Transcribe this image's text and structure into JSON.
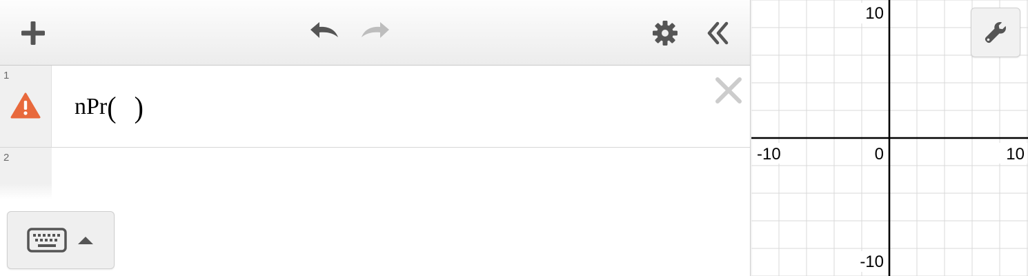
{
  "toolbar": {
    "add_icon": "plus-icon",
    "undo_icon": "undo-icon",
    "redo_icon": "redo-icon",
    "settings_icon": "gear-icon",
    "collapse_icon": "double-chevron-left-icon"
  },
  "expressions": [
    {
      "number": "1",
      "status_icon": "warning-icon",
      "function_name": "nPr",
      "open_paren": "(",
      "close_paren": ")",
      "delete_icon": "close-icon"
    },
    {
      "number": "2"
    }
  ],
  "keyboard": {
    "keyboard_icon": "keyboard-icon",
    "toggle_icon": "caret-up-icon"
  },
  "graph": {
    "x_min_label": "-10",
    "x_max_label": "10",
    "y_max_label": "10",
    "y_min_label": "-10",
    "origin_label": "0",
    "settings_icon": "wrench-icon"
  },
  "colors": {
    "warning": "#e8693c",
    "icon_dark": "#555555",
    "icon_disabled": "#bdbdbd",
    "grid_line": "#d9d9d9",
    "axis": "#000000"
  }
}
